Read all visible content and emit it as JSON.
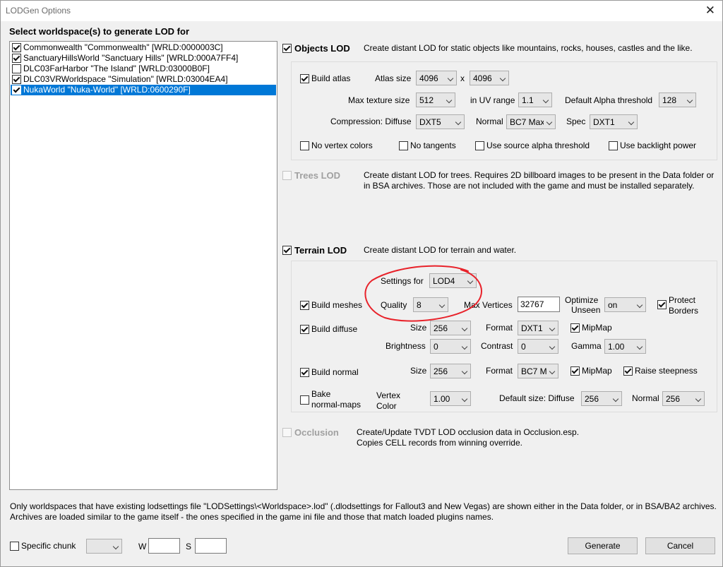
{
  "window": {
    "title": "LODGen Options",
    "close_glyph": "✕"
  },
  "worldspaces": {
    "heading": "Select worldspace(s) to generate LOD for",
    "items": [
      {
        "label": "Commonwealth \"Commonwealth\" [WRLD:0000003C]",
        "checked": true,
        "selected": false
      },
      {
        "label": "SanctuaryHillsWorld \"Sanctuary Hills\" [WRLD:000A7FF4]",
        "checked": true,
        "selected": false
      },
      {
        "label": "DLC03FarHarbor \"The Island\" [WRLD:03000B0F]",
        "checked": false,
        "selected": false
      },
      {
        "label": "DLC03VRWorldspace \"Simulation\" [WRLD:03004EA4]",
        "checked": true,
        "selected": false
      },
      {
        "label": "NukaWorld \"Nuka-World\" [WRLD:0600290F]",
        "checked": true,
        "selected": true
      }
    ]
  },
  "objects_lod": {
    "label": "Objects LOD",
    "checked": true,
    "description": "Create distant LOD for static objects like mountains, rocks, houses, castles and the like.",
    "build_atlas": {
      "label": "Build atlas",
      "checked": true
    },
    "atlas_size": {
      "label": "Atlas size",
      "w": "4096",
      "x": "x",
      "h": "4096"
    },
    "max_texture_size": {
      "label": "Max texture size",
      "value": "512"
    },
    "uv_range": {
      "label": "in UV range",
      "value": "1.1"
    },
    "alpha_threshold": {
      "label": "Default Alpha threshold",
      "value": "128"
    },
    "compression": {
      "label": "Compression: Diffuse",
      "diffuse": "DXT5",
      "normal_label": "Normal",
      "normal": "BC7 Max",
      "spec_label": "Spec",
      "spec": "DXT1"
    },
    "options": [
      {
        "label": "No vertex colors",
        "checked": false
      },
      {
        "label": "No tangents",
        "checked": false
      },
      {
        "label": "Use source alpha threshold",
        "checked": false
      },
      {
        "label": "Use backlight power",
        "checked": false
      }
    ]
  },
  "trees_lod": {
    "label": "Trees LOD",
    "checked": false,
    "enabled": false,
    "description_1": "Create distant LOD for trees. Requires 2D billboard images to be present in the Data folder or",
    "description_2": "in BSA archives. Those are not included with the game and must be installed separately."
  },
  "terrain_lod": {
    "label": "Terrain LOD",
    "checked": true,
    "description": "Create distant LOD for terrain and water.",
    "settings_for": {
      "label": "Settings for",
      "value": "LOD4"
    },
    "build_meshes": {
      "label": "Build meshes",
      "checked": true
    },
    "quality": {
      "label": "Quality",
      "value": "8"
    },
    "max_vertices": {
      "label": "Max Vertices",
      "value": "32767"
    },
    "optimize_unseen": {
      "label_1": "Optimize",
      "label_2": "Unseen",
      "value": "on"
    },
    "protect_borders": {
      "label_1": "Protect",
      "label_2": "Borders",
      "checked": true
    },
    "build_diffuse": {
      "label": "Build diffuse",
      "checked": true,
      "size_label": "Size",
      "size": "256",
      "format_label": "Format",
      "format": "DXT1",
      "mipmap_label": "MipMap",
      "mipmap": true
    },
    "brightness": {
      "label": "Brightness",
      "value": "0",
      "contrast_label": "Contrast",
      "contrast": "0",
      "gamma_label": "Gamma",
      "gamma": "1.00"
    },
    "build_normal": {
      "label": "Build normal",
      "checked": true,
      "size_label": "Size",
      "size": "256",
      "format_label": "Format",
      "format": "BC7 M",
      "mipmap_label": "MipMap",
      "mipmap": true,
      "raise_label": "Raise steepness",
      "raise": true
    },
    "bake_normal_maps": {
      "label_1": "Bake",
      "label_2": "normal-maps",
      "checked": false,
      "vertex_label_1": "Vertex",
      "vertex_label_2": "Color",
      "vertex_value": "1.00",
      "default_size_label": "Default size: Diffuse",
      "diffuse": "256",
      "normal_label": "Normal",
      "normal": "256"
    }
  },
  "occlusion": {
    "label": "Occlusion",
    "checked": false,
    "enabled": false,
    "description_1": "Create/Update TVDT LOD occlusion data in Occlusion.esp.",
    "description_2": "Copies CELL records from winning override."
  },
  "annotation": {
    "color": "#e8222a"
  },
  "footer": {
    "note_1": "Only worldspaces that have existing lodsettings file \"LODSettings\\<Worldspace>.lod\" (.dlodsettings for Fallout3 and New Vegas) are shown either in the Data folder, or in BSA/BA2 archives.",
    "note_2": "Archives are loaded similar to the game itself - the ones specified in the game ini file and those that match loaded plugins names.",
    "specific_chunk": {
      "label": "Specific chunk",
      "checked": false,
      "value": ""
    },
    "w_label": "W",
    "w_value": "",
    "s_label": "S",
    "s_value": "",
    "generate": "Generate",
    "cancel": "Cancel"
  }
}
